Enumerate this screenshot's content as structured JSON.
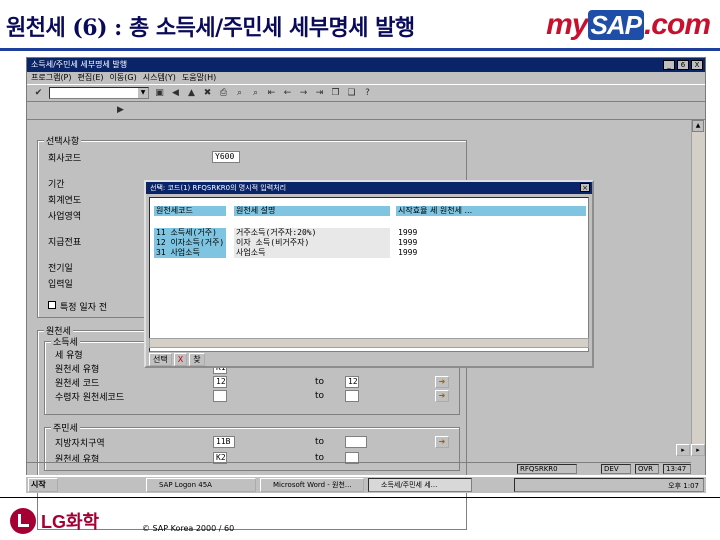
{
  "slide": {
    "title": "원천세 (6) : 총 소득세/주민세 세부명세 발행",
    "logo_my": "my",
    "logo_sap": "SAP",
    "logo_com": ".com",
    "copyright": "© SAP Korea 2000 / 60",
    "footer_logo": "LG화학"
  },
  "window": {
    "title": "소득세/주민세 세부명세 발행",
    "menu": [
      "프로그램(P)",
      "편집(E)",
      "이동(G)",
      "시스템(Y)",
      "도움말(H)"
    ],
    "min_label": "_",
    "max_label": "6",
    "close_label": "X"
  },
  "selection": {
    "group_label": "선택사항",
    "company_code_label": "회사코드",
    "company_code_value": "Y600",
    "posting_period_label": "기간",
    "fiscal_year_label": "회계연도",
    "business_area_label": "사업영역",
    "section_label": "지급전표",
    "doc_date_label": "전기일",
    "entry_date_label": "입력일",
    "checkbox_label": "특정 일자 전",
    "to": "to"
  },
  "tax": {
    "group_label": "원천세",
    "income_tax_label": "소득세",
    "tax_type_label": "세 유형",
    "wht_type_label": "원천세 유형",
    "wht_code_label": "원천세 코드",
    "wht_code_from": "12",
    "wht_code_to": "12",
    "recipient_label": "수령자 원천세코드",
    "wht_type_value": "K1",
    "resident_tax_label": "주민세",
    "region_label": "지방자치구역",
    "region_value": "11B",
    "resident_type_label": "원천세 유형",
    "resident_type_value": "K2"
  },
  "dialog": {
    "title": "선택: 코드(1) RFQSRKR0의 명시적 입력처리",
    "headers": [
      "원천세코드",
      "원천세 설명",
      "시작효율 세 원천세 ..."
    ],
    "rows": [
      {
        "code": "11 소득세(거주)",
        "desc": "거주소득(거주자:20%)",
        "year": "1999"
      },
      {
        "code": "12 이자소득(거주)",
        "desc": "이자 소득(비거주자)",
        "year": "1999"
      },
      {
        "code": "31 사업소득",
        "desc": "사업소득",
        "year": "1999"
      }
    ],
    "btn_select": "선택",
    "btn_cancel": "X",
    "btn_search": "찾"
  },
  "status": {
    "program": "RFQSRKR0",
    "client": "DEV",
    "system": "OVR",
    "time": "13:47"
  },
  "taskbar": {
    "start": "시작",
    "tasks": [
      "SAP Logon 45A",
      "Microsoft Word - 원천...",
      "소득세/주민세 세..."
    ],
    "clock": "오후 1:07"
  }
}
